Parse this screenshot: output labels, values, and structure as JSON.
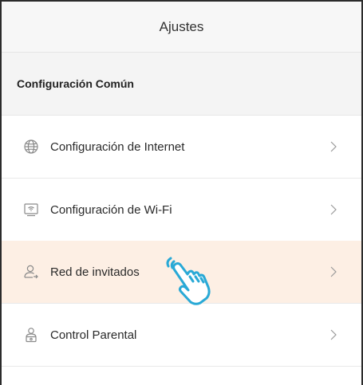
{
  "header": {
    "title": "Ajustes"
  },
  "section": {
    "title": "Configuración Común"
  },
  "menu": [
    {
      "label": "Configuración de Internet",
      "icon": "globe-icon"
    },
    {
      "label": "Configuración de Wi-Fi",
      "icon": "wifi-router-icon"
    },
    {
      "label": "Red de invitados",
      "icon": "guest-user-icon",
      "highlighted": true
    },
    {
      "label": "Control Parental",
      "icon": "parental-control-icon"
    }
  ],
  "colors": {
    "highlight_bg": "#fdefe4",
    "pointer_cyan": "#29a9d6",
    "icon_gray": "#8a8a8a"
  },
  "overlay": {
    "icon": "tap-hand-pointer-icon"
  }
}
